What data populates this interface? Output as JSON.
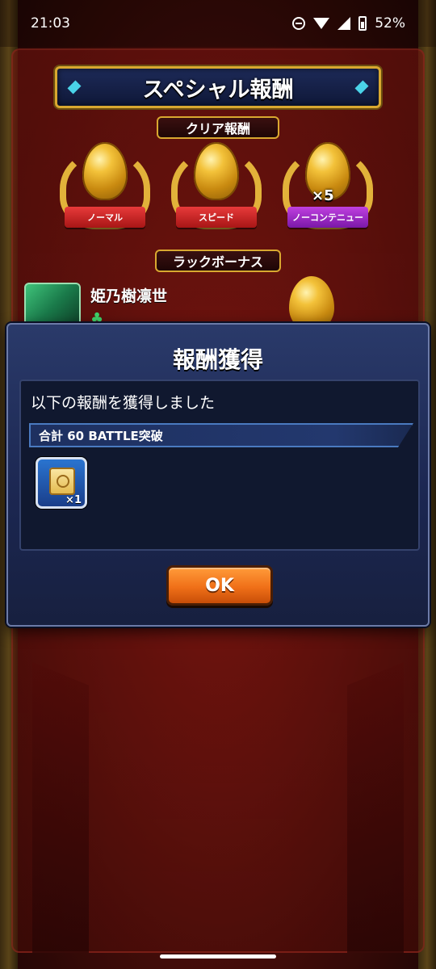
{
  "status_bar": {
    "time": "21:03",
    "battery": "52%"
  },
  "header": {
    "title": "スペシャル報酬",
    "clear_reward_label": "クリア報酬",
    "luck_bonus_label": "ラックボーナス"
  },
  "clear_rewards": [
    {
      "ribbon": "ノーマル",
      "ribbon_color": "#d02424",
      "multiplier": ""
    },
    {
      "ribbon": "スピード",
      "ribbon_color": "#d02424",
      "multiplier": ""
    },
    {
      "ribbon": "ノーコンテニュー",
      "ribbon_color": "#9a28c8",
      "multiplier": "×5"
    }
  ],
  "luck_bonus": {
    "character_name": "姫乃樹凛世",
    "clover_icon": "clover-icon"
  },
  "dialog": {
    "title": "報酬獲得",
    "message": "以下の報酬を獲得しました",
    "achievement": "合計 60 BATTLE突破",
    "item": {
      "icon": "scroll-icon",
      "count": "×1"
    },
    "ok_label": "OK"
  },
  "colors": {
    "ok_button": "#f07018",
    "dialog_bg": "#1b2650",
    "gold_frame": "#d9a830"
  }
}
